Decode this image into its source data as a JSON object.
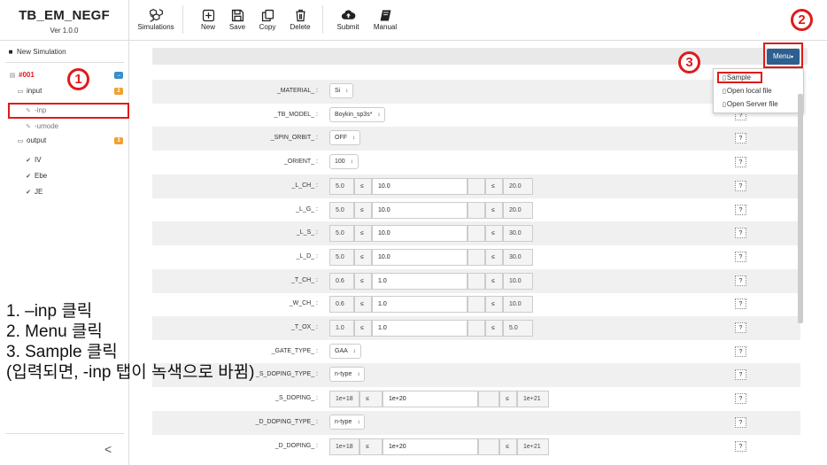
{
  "app": {
    "title": "TB_EM_NEGF",
    "version": "Ver 1.0.0"
  },
  "toolbar": {
    "simulations": "Simulations",
    "new": "New",
    "save": "Save",
    "copy": "Copy",
    "delete": "Delete",
    "submit": "Submit",
    "manual": "Manual"
  },
  "sidebar": {
    "new_simulation": "New Simulation",
    "sim_id": "#001",
    "sim_badge": "→",
    "input_label": "input",
    "input_badge": "2",
    "inp_label": "-inp",
    "umode_label": "-umode",
    "output_label": "output",
    "output_badge": "3",
    "out_items": [
      "IV",
      "Ebe",
      "JE"
    ],
    "collapse": "<"
  },
  "menu": {
    "button": "Menu",
    "items": [
      "Sample",
      "Open local file",
      "Open Server file"
    ]
  },
  "params": [
    {
      "label": "_MATERIAL_ :",
      "kind": "select",
      "value": "Si"
    },
    {
      "label": "_TB_MODEL_ :",
      "kind": "select",
      "value": "Boykin_sp3s*"
    },
    {
      "label": "_SPIN_ORBIT_ :",
      "kind": "select",
      "value": "OFF"
    },
    {
      "label": "_ORIENT_ :",
      "kind": "select",
      "value": "100"
    },
    {
      "label": "_L_CH_ :",
      "kind": "range",
      "min": "5.0",
      "value": "10.0",
      "max": "20.0"
    },
    {
      "label": "_L_G_ :",
      "kind": "range",
      "min": "5.0",
      "value": "10.0",
      "max": "20.0"
    },
    {
      "label": "_L_S_ :",
      "kind": "range",
      "min": "5.0",
      "value": "10.0",
      "max": "30.0"
    },
    {
      "label": "_L_D_ :",
      "kind": "range",
      "min": "5.0",
      "value": "10.0",
      "max": "30.0"
    },
    {
      "label": "_T_CH_ :",
      "kind": "range",
      "min": "0.6",
      "value": "1.0",
      "max": "10.0"
    },
    {
      "label": "_W_CH_ :",
      "kind": "range",
      "min": "0.6",
      "value": "1.0",
      "max": "10.0"
    },
    {
      "label": "_T_OX_ :",
      "kind": "range",
      "min": "1.0",
      "value": "1.0",
      "max": "5.0"
    },
    {
      "label": "_GATE_TYPE_ :",
      "kind": "select",
      "value": "GAA"
    },
    {
      "label": "_S_DOPING_TYPE_ :",
      "kind": "select",
      "value": "n-type"
    },
    {
      "label": "_S_DOPING_ :",
      "kind": "range",
      "min": "1e+18",
      "value": "1e+20",
      "max": "1e+21"
    },
    {
      "label": "_D_DOPING_TYPE_ :",
      "kind": "select",
      "value": "n-type"
    },
    {
      "label": "_D_DOPING_ :",
      "kind": "range",
      "min": "1e+18",
      "value": "1e+20",
      "max": "1e+21"
    }
  ],
  "leq": "≤",
  "help": "?",
  "annotations": {
    "circles": [
      "1",
      "2",
      "3"
    ],
    "instructions": [
      "1. –inp 클릭",
      "2. Menu 클릭",
      "3. Sample 클릭",
      "(입력되면, -inp 탭이 녹색으로 바뀜)"
    ]
  },
  "colors": {
    "accent": "#2d5f8f",
    "highlight": "#e01b1b",
    "badge_blue": "#3a8ec8",
    "badge_orange": "#f0a030"
  }
}
